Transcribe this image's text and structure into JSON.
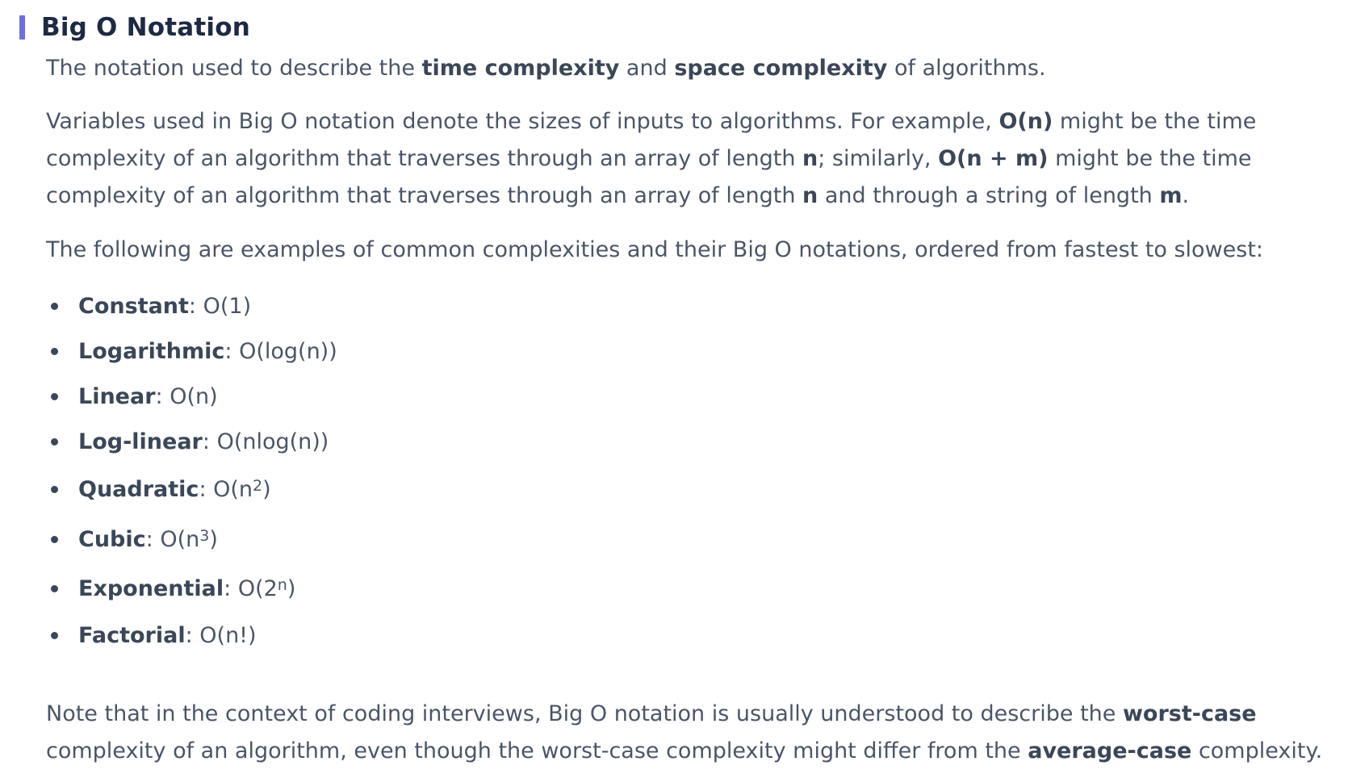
{
  "heading": "Big O Notation",
  "intro": {
    "t1": "The notation used to describe the ",
    "b1": "time complexity",
    "t2": " and ",
    "b2": "space complexity",
    "t3": " of algorithms."
  },
  "variables": {
    "t1": "Variables used in Big O notation denote the sizes of inputs to algorithms. For example, ",
    "b1": "O(n)",
    "t2": " might be the time complexity of an algorithm that traverses through an array of length ",
    "b2": "n",
    "t3": "; similarly, ",
    "b3": "O(n + m)",
    "t4": " might be the time complexity of an algorithm that traverses through an array of length ",
    "b4": "n",
    "t5": " and through a string of length ",
    "b5": "m",
    "t6": "."
  },
  "list_intro": "The following are examples of common complexities and their Big O notations, ordered from fastest to slowest:",
  "complexities": [
    {
      "name": "Constant",
      "sep": ": ",
      "notation": "O(1)",
      "sup": "",
      "close": ""
    },
    {
      "name": "Logarithmic",
      "sep": ": ",
      "notation": "O(log(n))",
      "sup": "",
      "close": ""
    },
    {
      "name": "Linear",
      "sep": ": ",
      "notation": "O(n)",
      "sup": "",
      "close": ""
    },
    {
      "name": "Log-linear",
      "sep": ": ",
      "notation": "O(nlog(n))",
      "sup": "",
      "close": ""
    },
    {
      "name": "Quadratic",
      "sep": ": ",
      "notation": "O(n",
      "sup": "2",
      "close": ")"
    },
    {
      "name": "Cubic",
      "sep": ": ",
      "notation": "O(n",
      "sup": "3",
      "close": ")"
    },
    {
      "name": "Exponential",
      "sep": ": ",
      "notation": "O(2",
      "sup": "n",
      "close": ")"
    },
    {
      "name": "Factorial",
      "sep": ": ",
      "notation": "O(n!)",
      "sup": "",
      "close": ""
    }
  ],
  "note": {
    "t1": "Note that in the context of coding interviews, Big O notation is usually understood to describe the ",
    "b1": "worst-case",
    "t2": " complexity of an algorithm, even though the worst-case complexity might differ from the ",
    "b2": "average-case",
    "t3": " complexity."
  },
  "colors": {
    "accent_bar": "#6c6ee8",
    "heading": "#1e2a44",
    "body_text": "#4a5568"
  }
}
